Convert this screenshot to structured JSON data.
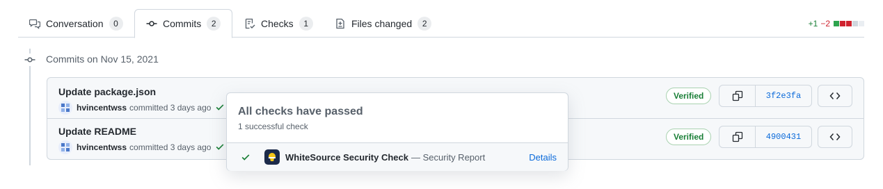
{
  "tabs": [
    {
      "label": "Conversation",
      "count": "0",
      "icon": "comment-discussion-icon"
    },
    {
      "label": "Commits",
      "count": "2",
      "icon": "git-commit-icon",
      "selected": true
    },
    {
      "label": "Checks",
      "count": "1",
      "icon": "checklist-icon"
    },
    {
      "label": "Files changed",
      "count": "2",
      "icon": "file-diff-icon"
    }
  ],
  "diffstat": {
    "additions": "+1",
    "deletions": "−2",
    "add_color": "#2da44e",
    "del_color": "#cf222e",
    "neutral_color": "#d0d7de"
  },
  "timeline": {
    "heading": "Commits on Nov 15, 2021"
  },
  "commits": [
    {
      "title": "Update package.json",
      "author": "hvincentwss",
      "action": "committed 3 days ago",
      "verified": "Verified",
      "sha": "3f2e3fa"
    },
    {
      "title": "Update README",
      "author": "hvincentwss",
      "action": "committed 3 days ago",
      "verified": "Verified",
      "sha": "4900431"
    }
  ],
  "popover": {
    "title": "All checks have passed",
    "subtitle": "1 successful check",
    "check": {
      "name": "WhiteSource Security Check",
      "description": "— Security Report",
      "link": "Details"
    }
  },
  "colors": {
    "success": "#1a7f37",
    "link": "#0969da",
    "border": "#d0d7de"
  }
}
